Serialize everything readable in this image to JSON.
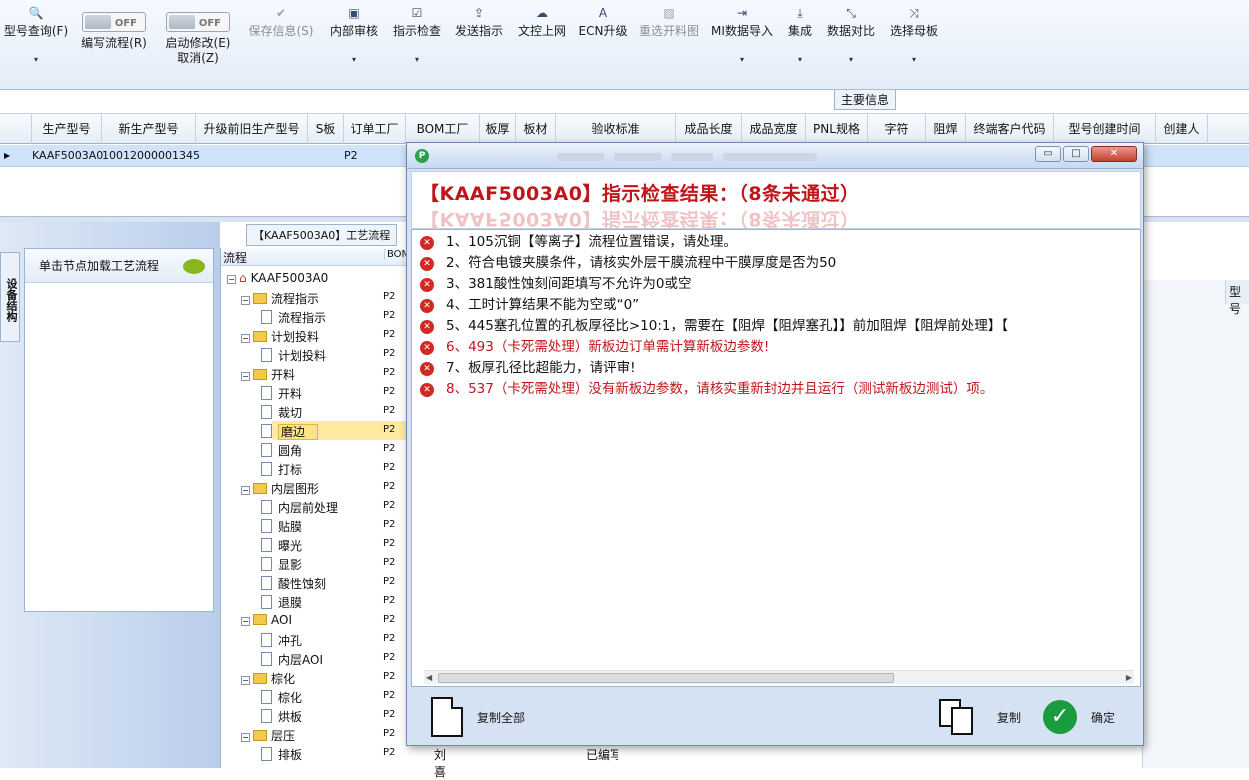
{
  "toolbar": {
    "model_query": "型号查询(F)",
    "write_flow": "编写流程(R)",
    "start_modify": "启动修改(E)",
    "cancel": "取消(Z)",
    "toggle_off": "OFF",
    "save_info": "保存信息(S)",
    "internal_review": "内部审核",
    "instr_check": "指示检查",
    "send_instr": "发送指示",
    "upload_net": "文控上网",
    "ecn_upgrade": "ECN升级",
    "reselect_cut": "重选开料图",
    "mi_import": "MI数据导入",
    "integrate": "集成",
    "data_compare": "数据对比",
    "select_master": "选择母板"
  },
  "band": {
    "main_info_tab": "主要信息"
  },
  "grid": {
    "columns": [
      "生产型号",
      "新生产型号",
      "升级前旧生产型号",
      "S板",
      "订单工厂",
      "BOM工厂",
      "板厚",
      "板材",
      "验收标准",
      "成品长度",
      "成品宽度",
      "PNL规格",
      "字符",
      "阻焊",
      "终端客户代码",
      "型号创建时间",
      "创建人"
    ],
    "row": {
      "model": "KAAF5003A0",
      "new_model": "10012000001345",
      "factory": "P2"
    }
  },
  "left": {
    "side_tab": "设备结构",
    "load_hint": "单击节点加载工艺流程"
  },
  "flow": {
    "title": "【KAAF5003A0】工艺流程",
    "col_flow": "流程",
    "col_bom": "BOM",
    "nodes": [
      {
        "label": "KAAF5003A0",
        "val": "",
        "type": "root"
      },
      {
        "label": "流程指示",
        "val": "P2",
        "type": "folder"
      },
      {
        "label": "流程指示",
        "val": "P2",
        "type": "doc"
      },
      {
        "label": "计划投料",
        "val": "P2",
        "type": "folder"
      },
      {
        "label": "计划投料",
        "val": "P2",
        "type": "doc"
      },
      {
        "label": "开料",
        "val": "P2",
        "type": "folder"
      },
      {
        "label": "开料",
        "val": "P2",
        "type": "doc"
      },
      {
        "label": "裁切",
        "val": "P2",
        "type": "doc"
      },
      {
        "label": "磨边",
        "val": "P2",
        "type": "doc"
      },
      {
        "label": "圆角",
        "val": "P2",
        "type": "doc"
      },
      {
        "label": "打标",
        "val": "P2",
        "type": "doc"
      },
      {
        "label": "内层图形",
        "val": "P2",
        "type": "folder"
      },
      {
        "label": "内层前处理",
        "val": "P2",
        "type": "doc"
      },
      {
        "label": "贴膜",
        "val": "P2",
        "type": "doc"
      },
      {
        "label": "曝光",
        "val": "P2",
        "type": "doc"
      },
      {
        "label": "显影",
        "val": "P2",
        "type": "doc"
      },
      {
        "label": "酸性蚀刻",
        "val": "P2",
        "type": "doc"
      },
      {
        "label": "退膜",
        "val": "P2",
        "type": "doc"
      },
      {
        "label": "AOI",
        "val": "P2",
        "type": "folder"
      },
      {
        "label": "冲孔",
        "val": "P2",
        "type": "doc"
      },
      {
        "label": "内层AOI",
        "val": "P2",
        "type": "doc"
      },
      {
        "label": "棕化",
        "val": "P2",
        "type": "folder"
      },
      {
        "label": "棕化",
        "val": "P2",
        "type": "doc"
      },
      {
        "label": "烘板",
        "val": "P2",
        "type": "doc"
      },
      {
        "label": "层压",
        "val": "P2",
        "type": "folder"
      },
      {
        "label": "排板",
        "val": "P2",
        "type": "doc"
      }
    ],
    "selected_index": 8
  },
  "bottom": {
    "name": "刘喜",
    "status": "已编写"
  },
  "right": {
    "header": "型号"
  },
  "dialog": {
    "headline": "【KAAF5003A0】指示检查结果：（8条未通过）",
    "messages": [
      {
        "text": "1、105沉铜【等离子】流程位置错误，请处理。",
        "red": false
      },
      {
        "text": "2、符合电镀夹膜条件，请核实外层干膜流程中干膜厚度是否为50",
        "red": false
      },
      {
        "text": "3、381酸性蚀刻间距填写不允许为0或空",
        "red": false
      },
      {
        "text": "4、工时计算结果不能为空或“0”",
        "red": false
      },
      {
        "text": "5、445塞孔位置的孔板厚径比>10:1，需要在【阻焊【阻焊塞孔】】前加阻焊【阻焊前处理】【",
        "red": false
      },
      {
        "text": "6、493（卡死需处理）新板边订单需计算新板边参数!",
        "red": true
      },
      {
        "text": "7、板厚孔径比超能力，请评审!",
        "red": false
      },
      {
        "text": "8、537（卡死需处理）没有新板边参数，请核实重新封边并且运行（测试新板边测试）项。",
        "red": true
      }
    ],
    "copy_all": "复制全部",
    "copy": "复制",
    "ok": "确定"
  },
  "colors": {
    "error_red": "#c0161b",
    "selection": "#fbe38a",
    "ok_green": "#1a9b3e"
  }
}
